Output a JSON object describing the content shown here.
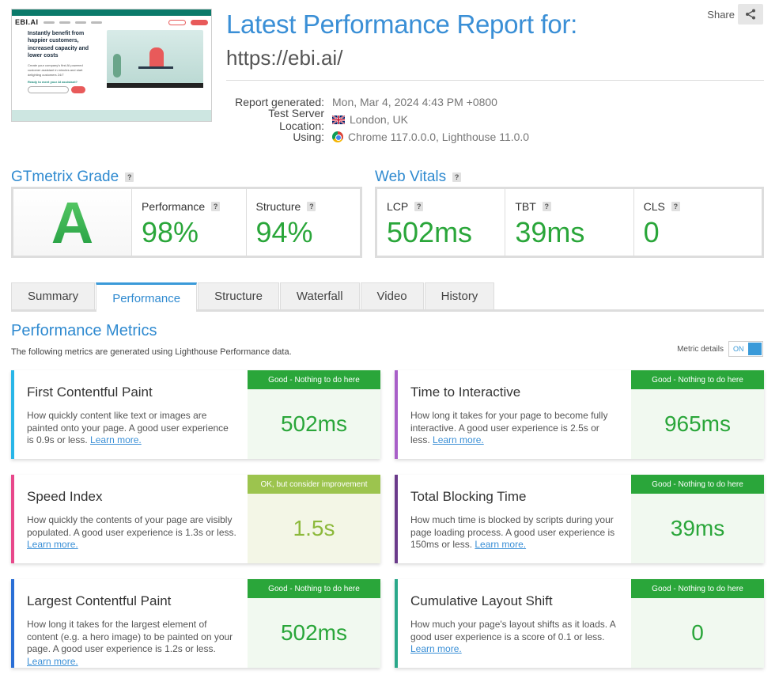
{
  "header": {
    "title": "Latest Performance Report for:",
    "url": "https://ebi.ai/",
    "share_label": "Share"
  },
  "thumbnail": {
    "logo": "EBI.AI",
    "headline": "Instantly benefit from happier customers, increased capacity and lower costs",
    "subtext": "Create your company's first AI powered customer assistant in minutes and start delighting customers 24/7",
    "cta_label": "Ready to meet your AI assistant?"
  },
  "info": {
    "report_generated_label": "Report generated:",
    "report_generated_value": "Mon, Mar 4, 2024 4:43 PM +0800",
    "location_label": "Test Server Location:",
    "location_value": "London, UK",
    "using_label": "Using:",
    "using_value": "Chrome 117.0.0.0, Lighthouse 11.0.0"
  },
  "grade": {
    "heading": "GTmetrix Grade",
    "letter": "A",
    "performance_label": "Performance",
    "performance_value": "98%",
    "structure_label": "Structure",
    "structure_value": "94%"
  },
  "vitals": {
    "heading": "Web Vitals",
    "lcp_label": "LCP",
    "lcp_value": "502ms",
    "tbt_label": "TBT",
    "tbt_value": "39ms",
    "cls_label": "CLS",
    "cls_value": "0"
  },
  "tabs": [
    "Summary",
    "Performance",
    "Structure",
    "Waterfall",
    "Video",
    "History"
  ],
  "active_tab": "Performance",
  "metrics_section": {
    "title": "Performance Metrics",
    "subtitle": "The following metrics are generated using Lighthouse Performance data.",
    "toggle_label": "Metric details",
    "toggle_state": "ON"
  },
  "metrics": [
    {
      "title": "First Contentful Paint",
      "desc": "How quickly content like text or images are painted onto your page. A good user experience is 0.9s or less.",
      "link": "Learn more.",
      "badge": "Good - Nothing to do here",
      "value": "502ms",
      "color": "#29b6e8"
    },
    {
      "title": "Time to Interactive",
      "desc": "How long it takes for your page to become fully interactive. A good user experience is 2.5s or less.",
      "link": "Learn more.",
      "badge": "Good - Nothing to do here",
      "value": "965ms",
      "color": "#a85fc8"
    },
    {
      "title": "Speed Index",
      "desc": "How quickly the contents of your page are visibly populated. A good user experience is 1.3s or less.",
      "link": "Learn more.",
      "badge": "OK, but consider improvement",
      "value": "1.5s",
      "color": "#e8488b"
    },
    {
      "title": "Total Blocking Time",
      "desc": "How much time is blocked by scripts during your page loading process. A good user experience is 150ms or less.",
      "link": "Learn more.",
      "badge": "Good - Nothing to do here",
      "value": "39ms",
      "color": "#6a3a8a"
    },
    {
      "title": "Largest Contentful Paint",
      "desc": "How long it takes for the largest element of content (e.g. a hero image) to be painted on your page. A good user experience is 1.2s or less.",
      "link": "Learn more.",
      "badge": "Good - Nothing to do here",
      "value": "502ms",
      "color": "#2a6fd6"
    },
    {
      "title": "Cumulative Layout Shift",
      "desc": "How much your page's layout shifts as it loads. A good user experience is a score of 0.1 or less.",
      "link": "Learn more.",
      "badge": "Good - Nothing to do here",
      "value": "0",
      "color": "#2aa88a"
    }
  ]
}
